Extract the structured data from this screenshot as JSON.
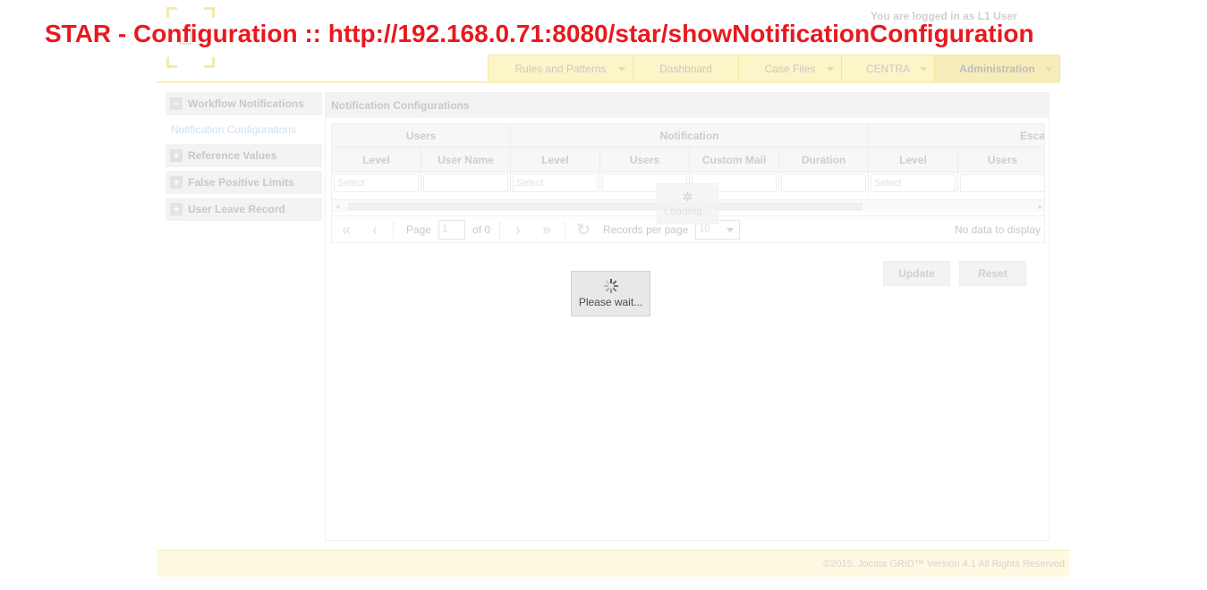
{
  "overlay_title": "STAR - Configuration :: http://192.168.0.71:8080/star/showNotificationConfiguration",
  "header": {
    "logged_in_text": "You are logged in as L1 User"
  },
  "nav": {
    "items": [
      {
        "label": "Rules and Patterns",
        "has_caret": true,
        "active": false
      },
      {
        "label": "Dashboard",
        "has_caret": false,
        "active": false
      },
      {
        "label": "Case Files",
        "has_caret": true,
        "active": false
      },
      {
        "label": "CENTRA",
        "has_caret": true,
        "active": false
      },
      {
        "label": "Administration",
        "has_caret": true,
        "active": true
      }
    ]
  },
  "sidebar": {
    "workflow_notifications": "Workflow Notifications",
    "notification_configurations": "Notification Configurations",
    "reference_values": "Reference Values",
    "false_positive_limits": "False Positive Limits",
    "user_leave_record": "User Leave Record"
  },
  "panel": {
    "title": "Notification Configurations"
  },
  "grid": {
    "groups": [
      "Users",
      "Notification",
      "Esca"
    ],
    "columns": [
      "Level",
      "User Name",
      "Level",
      "Users",
      "Custom Mail",
      "Duration",
      "Level",
      "Users"
    ],
    "filter_placeholder": "Select",
    "loading_text": "Loading..."
  },
  "pager": {
    "page_label": "Page",
    "page_value": "1",
    "of_label": "of 0",
    "records_label": "Records per page",
    "records_value": "10",
    "no_data": "No data to display"
  },
  "buttons": {
    "update": "Update",
    "reset": "Reset"
  },
  "wait": {
    "text": "Please wait..."
  },
  "footer": {
    "copyright": "©2015. Jocata GRID™ Version 4.1 All Rights Reserved"
  }
}
